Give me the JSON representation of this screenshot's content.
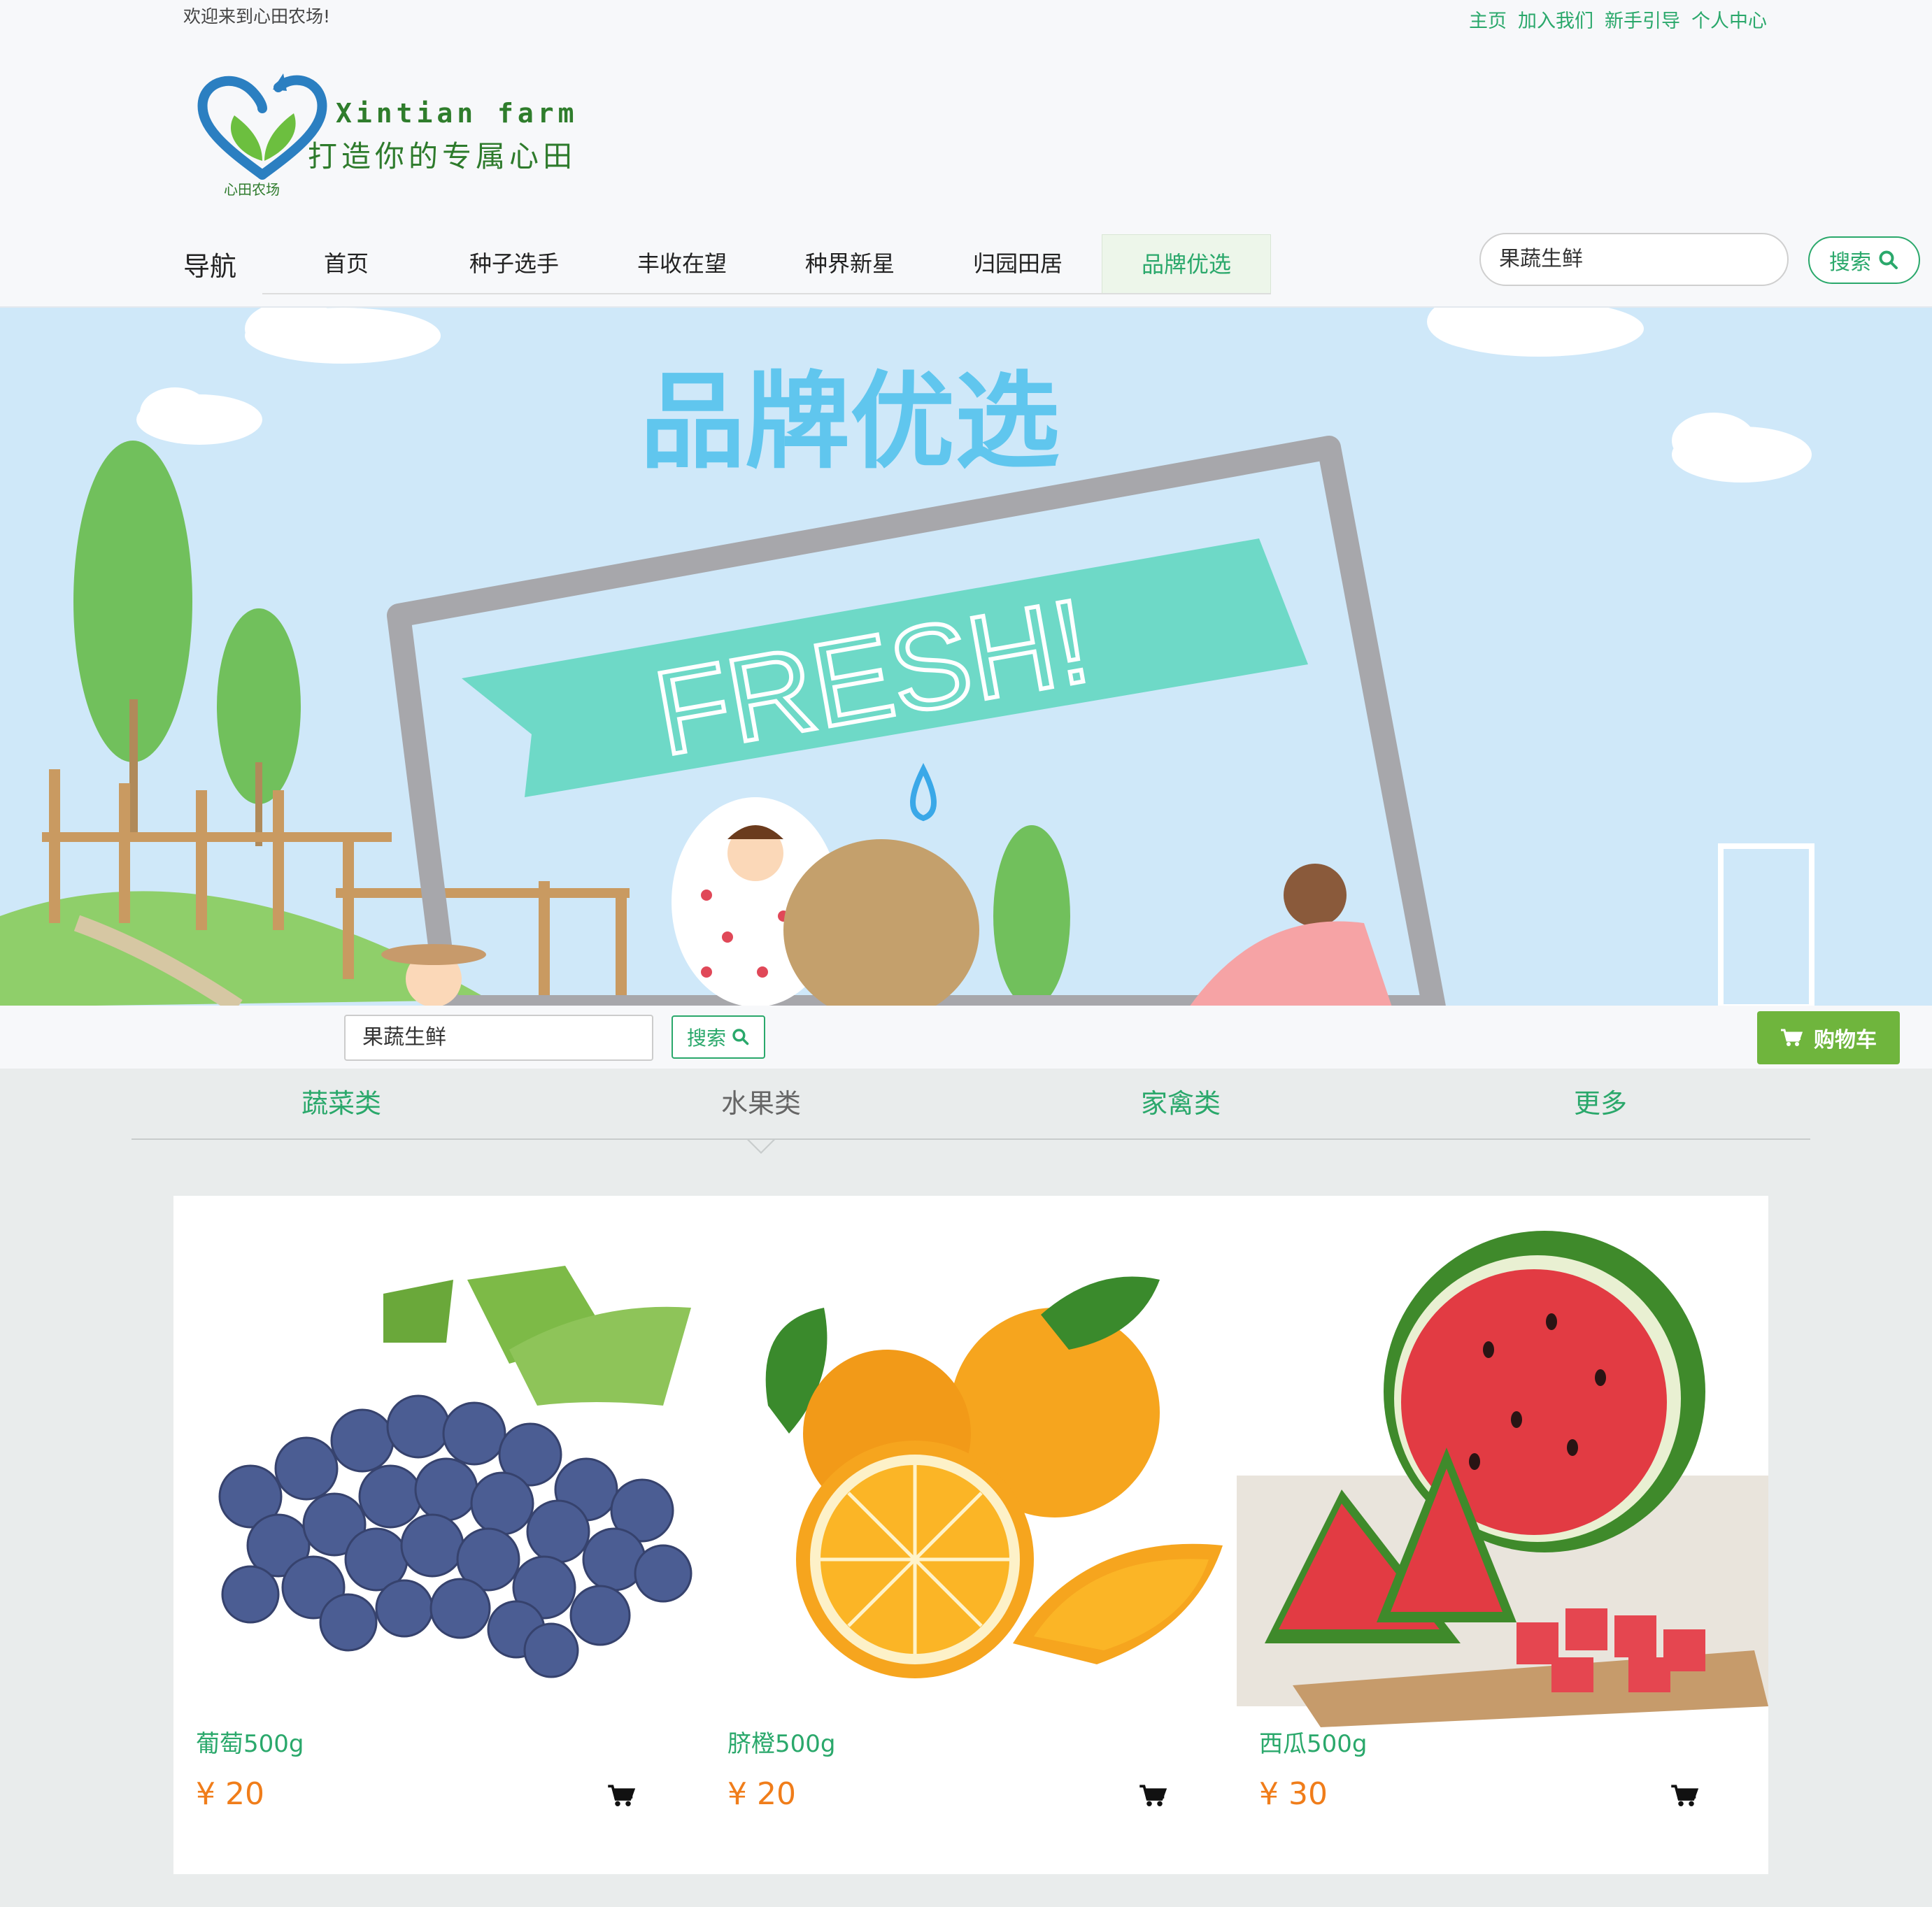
{
  "header": {
    "welcome": "欢迎来到心田农场!",
    "links": [
      "主页",
      "加入我们",
      "新手引导",
      "个人中心"
    ]
  },
  "logo": {
    "brand_en": "Xintian farm",
    "slogan": "打造你的专属心田",
    "small": "心田农场"
  },
  "nav": {
    "label": "导航",
    "items": [
      "首页",
      "种子选手",
      "丰收在望",
      "种界新星",
      "归园田居",
      "品牌优选"
    ],
    "active_index": 5,
    "search_value": "果蔬生鲜",
    "search_label": "搜索"
  },
  "banner": {
    "title": "品牌优选",
    "flag_text": "FRESH!"
  },
  "subbar": {
    "search_value": "果蔬生鲜",
    "search_label": "搜索",
    "cart_label": "购物车"
  },
  "categories": {
    "tabs": [
      "蔬菜类",
      "水果类",
      "家禽类",
      "更多"
    ],
    "active_index": 1
  },
  "products": [
    {
      "name": "葡萄500g",
      "price": "¥ 20",
      "image": "grapes"
    },
    {
      "name": "脐橙500g",
      "price": "¥ 20",
      "image": "oranges"
    },
    {
      "name": "西瓜500g",
      "price": "¥ 30",
      "image": "watermelon"
    }
  ],
  "colors": {
    "accent": "#2aa86b",
    "cart_button": "#6fb53d",
    "price": "#f07d1a",
    "banner_sky": "#cfe8f9"
  }
}
